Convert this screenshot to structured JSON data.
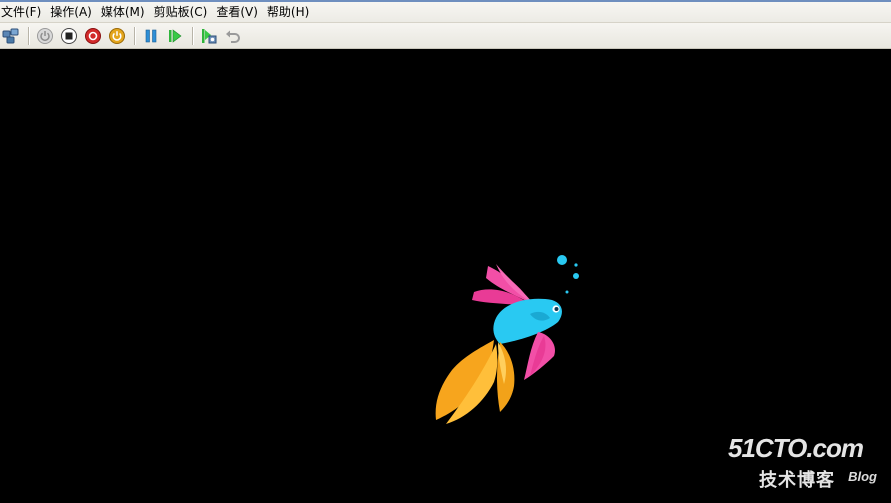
{
  "menubar": {
    "items": [
      {
        "label": "文件(F)"
      },
      {
        "label": "操作(A)"
      },
      {
        "label": "媒体(M)"
      },
      {
        "label": "剪贴板(C)"
      },
      {
        "label": "查看(V)"
      },
      {
        "label": "帮助(H)"
      }
    ]
  },
  "toolbar": {
    "buttons": [
      {
        "icon": "ctrl-alt-del-icon"
      },
      {
        "icon": "start-icon"
      },
      {
        "icon": "turn-off-icon"
      },
      {
        "icon": "shutdown-icon"
      },
      {
        "icon": "power-icon"
      },
      {
        "icon": "pause-icon"
      },
      {
        "icon": "resume-icon"
      },
      {
        "icon": "snapshot-icon"
      },
      {
        "icon": "revert-icon"
      }
    ]
  },
  "watermark": {
    "main": "51CTO.com",
    "sub": "技术博客",
    "blog": "Blog"
  },
  "colors": {
    "background": "#000000",
    "fish_body": "#29c9f2",
    "fish_fins_pink": "#f24fa7",
    "fish_tail_orange": "#f7a51d"
  }
}
